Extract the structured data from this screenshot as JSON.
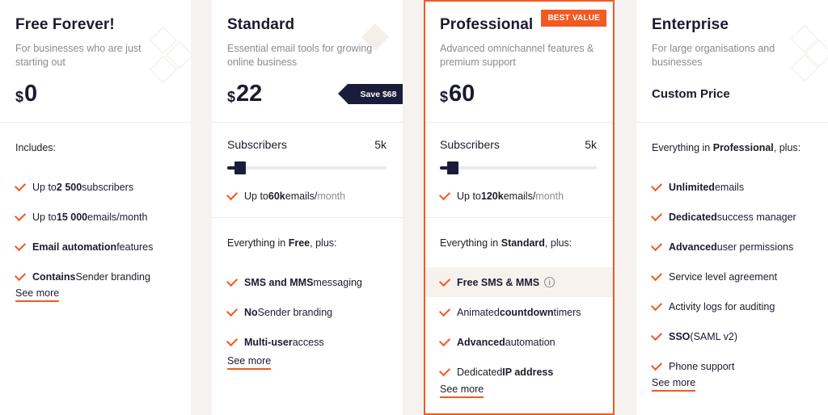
{
  "plans": [
    {
      "title": "Free Forever!",
      "subtitle": "For businesses who are just starting out",
      "currency": "$",
      "price": "0",
      "includes_label": "Includes:",
      "features": [
        {
          "pre": "Up to ",
          "bold": "2 500",
          "post": " subscribers"
        },
        {
          "pre": "Up to ",
          "bold": "15 000",
          "post": " emails/month"
        },
        {
          "pre": "",
          "bold": "Email automation",
          "post": " features"
        },
        {
          "pre": "",
          "bold": "Contains",
          "post": " Sender branding"
        }
      ],
      "see_more": "See more"
    },
    {
      "title": "Standard",
      "subtitle": "Essential email tools for growing online business",
      "currency": "$",
      "price": "22",
      "save_badge": "Save $68",
      "subscribers_label": "Subscribers",
      "subscribers_value": "5k",
      "slider_level": 0.08,
      "emails": {
        "pre": "Up to ",
        "bold": "60k",
        "mid": " emails/",
        "muted": "month"
      },
      "includes": {
        "pre": "Everything in ",
        "bold": "Free",
        "post": ", plus:"
      },
      "features": [
        {
          "pre": "",
          "bold": "SMS and MMS",
          "post": " messaging"
        },
        {
          "pre": "",
          "bold": "No",
          "post": " Sender branding"
        },
        {
          "pre": "",
          "bold": "Multi-user",
          "post": " access"
        }
      ],
      "see_more": "See more"
    },
    {
      "title": "Professional",
      "subtitle": "Advanced omnichannel features & premium support",
      "currency": "$",
      "price": "60",
      "best_badge": "BEST VALUE",
      "subscribers_label": "Subscribers",
      "subscribers_value": "5k",
      "slider_level": 0.08,
      "emails": {
        "pre": "Up to ",
        "bold": "120k",
        "mid": " emails/",
        "muted": "month"
      },
      "includes": {
        "pre": "Everything in ",
        "bold": "Standard",
        "post": ", plus:"
      },
      "features": [
        {
          "pre": "",
          "bold": "Free SMS & MMS",
          "post": "",
          "info": "i"
        },
        {
          "pre": "Animated ",
          "bold": "countdown",
          "post": " timers"
        },
        {
          "pre": "",
          "bold": "Advanced",
          "post": " automation"
        },
        {
          "pre": "Dedicated ",
          "bold": "IP address",
          "post": ""
        }
      ],
      "see_more": "See more"
    },
    {
      "title": "Enterprise",
      "subtitle": "For large organisations and businesses",
      "custom_price": "Custom Price",
      "includes": {
        "pre": "Everything in ",
        "bold": "Professional",
        "post": ", plus:"
      },
      "features": [
        {
          "pre": "",
          "bold": "Unlimited",
          "post": " emails"
        },
        {
          "pre": "",
          "bold": "Dedicated",
          "post": " success manager"
        },
        {
          "pre": "",
          "bold": "Advanced",
          "post": " user permissions"
        },
        {
          "pre": "Service level agreement",
          "bold": "",
          "post": ""
        },
        {
          "pre": "Activity logs for auditing",
          "bold": "",
          "post": ""
        },
        {
          "pre": "",
          "bold": "SSO",
          "post": " (SAML v2)"
        },
        {
          "pre": "Phone support",
          "bold": "",
          "post": ""
        }
      ],
      "see_more": "See more"
    }
  ],
  "colors": {
    "accent": "#f15a22",
    "navy": "#1b1b3a",
    "text": "#1b1b2f",
    "muted": "#8a8a94",
    "highlight": "#f8f2ee"
  }
}
